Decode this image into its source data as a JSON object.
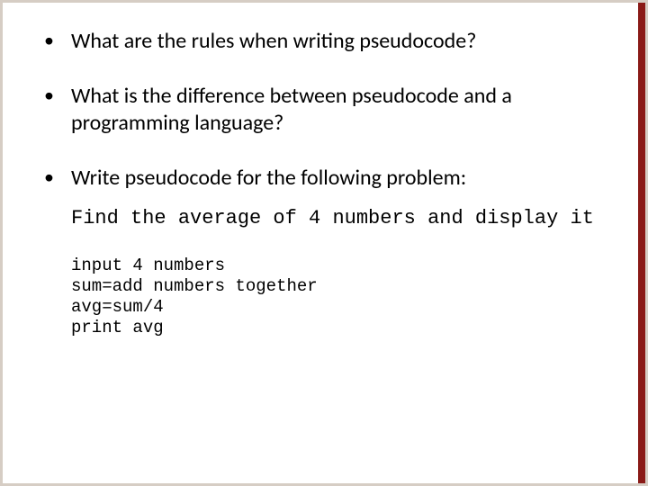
{
  "bullets": [
    "What are the rules when writing pseudocode?",
    "What is the difference between pseudocode and a programming language?",
    "Write pseudocode for the following problem:"
  ],
  "problem_statement": "Find the average of 4 numbers and display it",
  "pseudocode": "input 4 numbers\nsum=add numbers together\navg=sum/4\nprint avg"
}
